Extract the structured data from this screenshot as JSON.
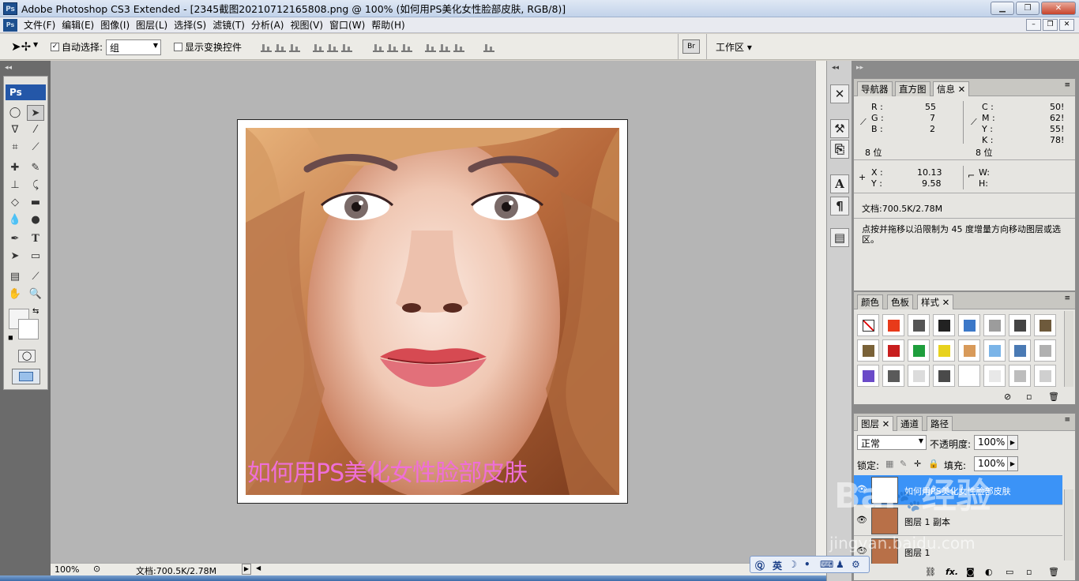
{
  "window": {
    "title": "Adobe Photoshop CS3 Extended - [2345截图20210712165808.png @ 100% (如何用PS美化女性脸部皮肤, RGB/8)]",
    "app_icon": "Ps",
    "controls": {
      "minimize": "▁",
      "maximize": "❐",
      "close": "✕"
    }
  },
  "menubar": {
    "logo": "Ps",
    "items": [
      "文件(F)",
      "编辑(E)",
      "图像(I)",
      "图层(L)",
      "选择(S)",
      "滤镜(T)",
      "分析(A)",
      "视图(V)",
      "窗口(W)",
      "帮助(H)"
    ],
    "doc_controls": {
      "minimize": "–",
      "restore": "❐",
      "close": "✕"
    }
  },
  "options": {
    "auto_select_label": "自动选择:",
    "auto_select_checked": true,
    "auto_select_value": "组",
    "show_transform_label": "显示变换控件",
    "show_transform_checked": false,
    "workspace_label": "工作区 ▾"
  },
  "toolbox": {
    "logo": "Ps",
    "tools": [
      "marquee-ellipse",
      "move",
      "lasso",
      "magic-wand",
      "crop",
      "eyedropper-slice",
      "healing",
      "brush",
      "clone-stamp",
      "history-brush",
      "eraser",
      "gradient",
      "blur",
      "dodge",
      "pen",
      "type",
      "path-select",
      "rectangle",
      "notes",
      "eyedropper",
      "hand",
      "zoom"
    ],
    "type_tool_glyph": "T"
  },
  "document": {
    "caption": "如何用PS美化女性脸部皮肤"
  },
  "status": {
    "zoom": "100%",
    "doc_size": "文档:700.5K/2.78M"
  },
  "info_panel": {
    "tabs": [
      "导航器",
      "直方图",
      "信息"
    ],
    "active_tab": "信息",
    "rgb": {
      "R": "55",
      "G": "7",
      "B": "2"
    },
    "cmyk": {
      "C": "50!",
      "M": "62!",
      "Y": "55!",
      "K": "78!"
    },
    "bit_depth_left": "8 位",
    "bit_depth_right": "8 位",
    "coords": {
      "X": "10.13",
      "Y": "9.58"
    },
    "size_labels": {
      "W": "W:",
      "H": "H:"
    },
    "doc_info": "文档:700.5K/2.78M",
    "hint": "点按并拖移以沿限制为 45 度增量方向移动图层或选区。"
  },
  "styles_panel": {
    "tabs": [
      "颜色",
      "色板",
      "样式"
    ],
    "active_tab": "样式",
    "swatch_colors": [
      "none",
      "#e83a1a",
      "#555555",
      "#222222",
      "#3c78c8",
      "#9c9c9c",
      "#444444",
      "#6e5a3c",
      "#7a6238",
      "#c81e1e",
      "#1e9e3c",
      "#e8d21e",
      "#d89a5a",
      "#7ab4e8",
      "#4a7ab4",
      "#b0b0b0",
      "#6a4ac8",
      "#5a5a5a",
      "#dcdcdc",
      "#4a4a4a",
      "#ffffff",
      "#e8e8e8",
      "#bdbdbd",
      "#cfcfcf"
    ]
  },
  "layers_panel": {
    "tabs": [
      "图层",
      "通道",
      "路径"
    ],
    "active_tab": "图层",
    "blend_mode": "正常",
    "opacity_label": "不透明度:",
    "opacity": "100%",
    "lock_label": "锁定:",
    "fill_label": "填充:",
    "fill": "100%",
    "layers": [
      {
        "name": "如何用PS美化女性脸部皮肤",
        "type": "text",
        "selected": true
      },
      {
        "name": "图层 1 副本",
        "type": "image",
        "selected": false
      },
      {
        "name": "图层 1",
        "type": "image",
        "selected": false
      }
    ]
  },
  "ime": {
    "lang": "英"
  },
  "watermark": {
    "text1": "Bai",
    "text2": "经验",
    "url": "jingyan.baidu.com"
  }
}
